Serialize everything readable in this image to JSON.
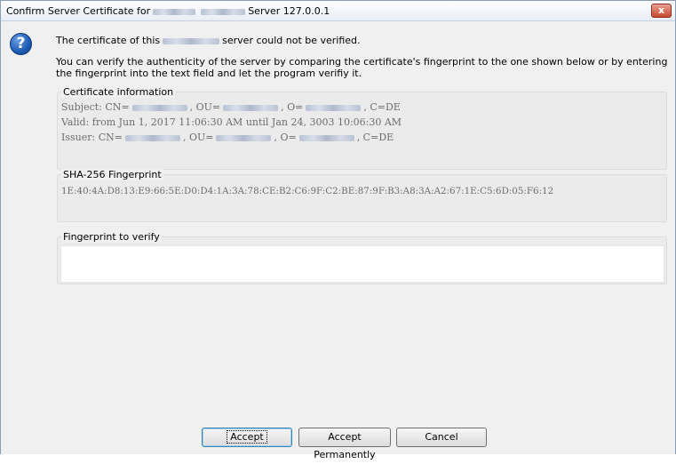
{
  "window": {
    "title_prefix": "Confirm Server Certificate for",
    "title_suffix": "Server 127.0.0.1",
    "close_label": "x"
  },
  "dialog": {
    "icon": "question-icon",
    "message_prefix": "The certificate of this",
    "message_suffix": "server could not be verified.",
    "instructions": "You can verify the authenticity of the server by comparing the certificate's fingerprint to the one shown below or by entering the fingerprint into the text field and let the program verifiy it."
  },
  "certificate": {
    "label": "Certificate information",
    "subject_prefix": "Subject: CN=",
    "subject_ou": ", OU=",
    "subject_o": ", O=",
    "subject_c": ", C=DE",
    "valid": "Valid: from Jun 1, 2017 11:06:30 AM until Jan 24, 3003 10:06:30 AM",
    "issuer_prefix": "Issuer: CN=",
    "issuer_ou": ", OU=",
    "issuer_o": ", O=",
    "issuer_c": ", C=DE"
  },
  "fingerprint": {
    "label": "SHA-256 Fingerprint",
    "value": "1E:40:4A:D8:13:E9:66:5E:D0:D4:1A:3A:78:CE:B2:C6:9F:C2:BE:87:9F:B3:A8:3A:A2:67:1E:C5:6D:05:F6:12"
  },
  "verify": {
    "label": "Fingerprint to verify",
    "value": ""
  },
  "buttons": {
    "accept": "Accept",
    "accept_permanently": "Accept Permanently",
    "cancel": "Cancel"
  },
  "colors": {
    "close_button": "#c94a32",
    "icon_blue": "#1d5bb5",
    "default_button_border": "#3c7fb1"
  }
}
